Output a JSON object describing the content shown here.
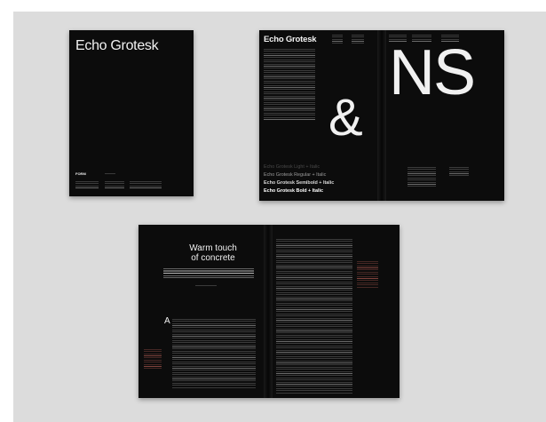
{
  "cover": {
    "title": "Echo Grotesk",
    "foundry": "FORM"
  },
  "spread_top": {
    "title": "Echo Grotesk",
    "ampersand": "&",
    "letters": "NS",
    "styles": [
      "Echo Grotesk Light + Italic",
      "Echo Grotesk Regular + Italic",
      "Echo Grotesk Semibold + Italic",
      "Echo Grotesk Bold + Italic"
    ]
  },
  "spread_bottom": {
    "headline_line1": "Warm touch",
    "headline_line2": "of concrete",
    "drop_cap": "A"
  },
  "colors": {
    "background": "#dcdcdc",
    "paper": "#0c0c0c",
    "text": "#f1f1f1",
    "accent": "#a5544c"
  }
}
